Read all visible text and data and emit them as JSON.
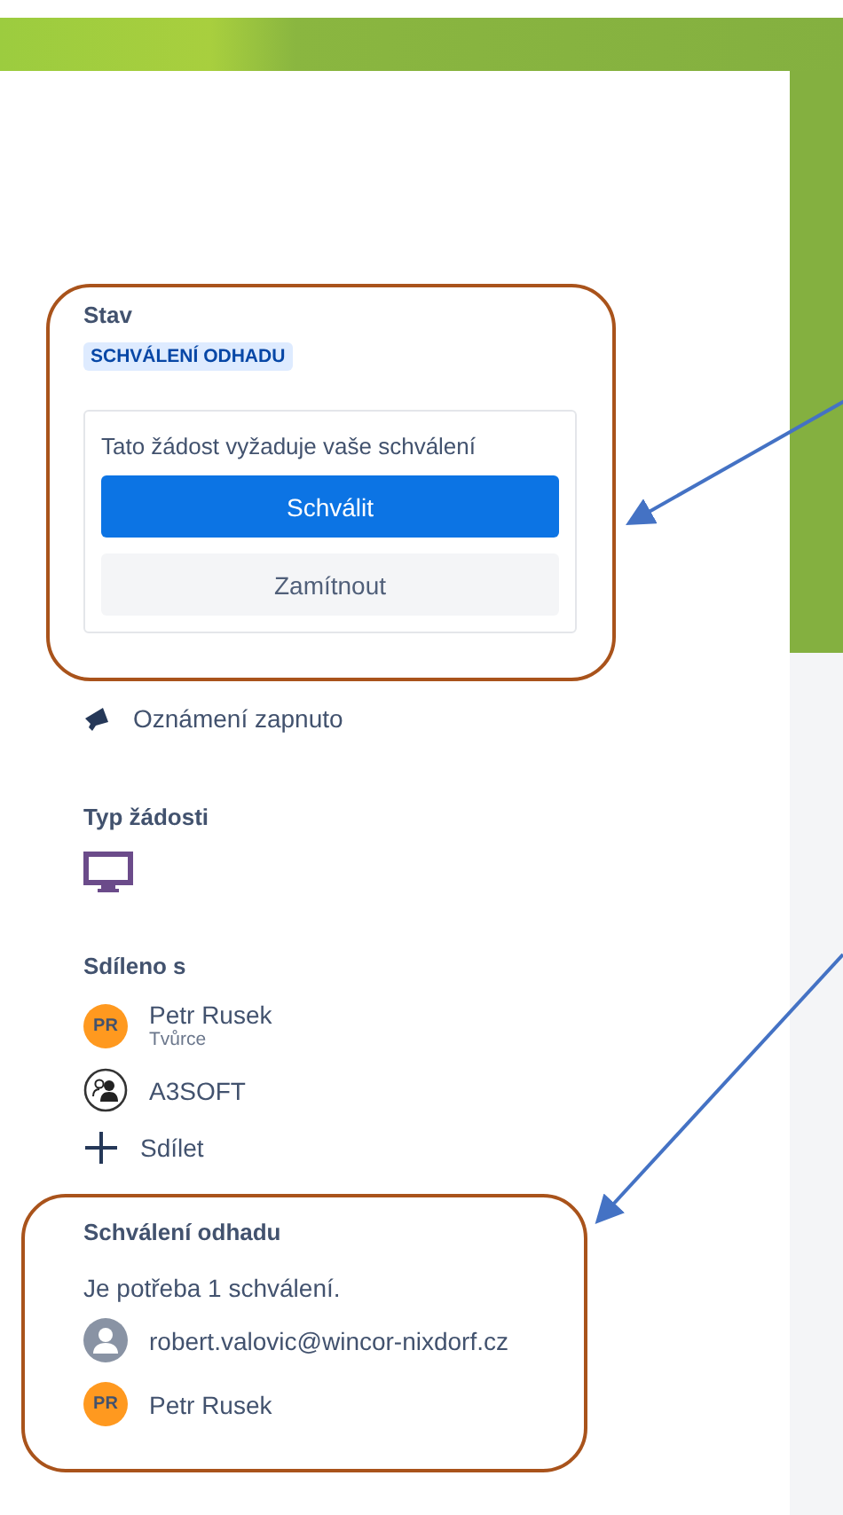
{
  "status": {
    "label": "Stav",
    "badge": "SCHVÁLENÍ ODHADU",
    "approval_card": {
      "message": "Tato žádost vyžaduje vaše schválení",
      "buttons": [
        {
          "label": "Schválit",
          "kind": "primary"
        },
        {
          "label": "Zamítnout",
          "kind": "secondary"
        }
      ]
    }
  },
  "notifications": {
    "label": "Oznámení zapnuto"
  },
  "request_type": {
    "label": "Typ žádosti"
  },
  "shared_with": {
    "label": "Sdíleno s",
    "people": [
      {
        "kind": "initials",
        "initials": "PR",
        "name": "Petr Rusek",
        "role": "Tvůrce"
      },
      {
        "kind": "group",
        "name": "A3SOFT"
      }
    ],
    "add_label": "Sdílet"
  },
  "estimate_approval": {
    "title": "Schválení odhadu",
    "note": "Je potřeba 1 schválení.",
    "approvers": [
      {
        "kind": "generic",
        "name": "robert.valovic@wincor-nixdorf.cz"
      },
      {
        "kind": "initials",
        "initials": "PR",
        "name": "Petr Rusek"
      }
    ]
  }
}
